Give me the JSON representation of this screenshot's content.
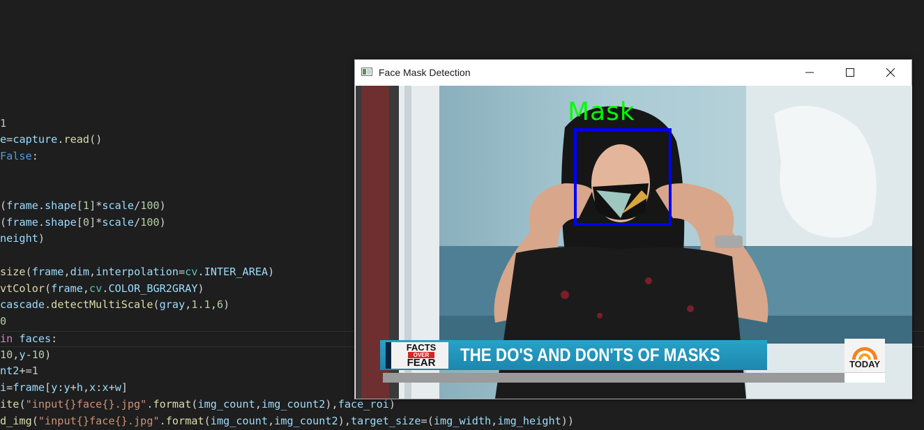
{
  "editor": {
    "lines": [
      [
        "<span class='n'>1</span>"
      ],
      [
        "<span class='v'>e</span>=<span class='v'>capture</span>.<span class='f'>read</span>()"
      ],
      [
        "<span class='k'>False</span>:"
      ],
      [
        "(<span class='v'>frame</span>.<span class='v'>shape</span>[<span class='n'>1</span>]*<span class='v'>scale</span>/<span class='n'>100</span>)"
      ],
      [
        "(<span class='v'>frame</span>.<span class='v'>shape</span>[<span class='n'>0</span>]*<span class='v'>scale</span>/<span class='n'>100</span>)"
      ],
      [
        "<span class='v'>neight</span>)"
      ],
      [
        "<span class='f'>size</span>(<span class='v'>frame</span>,<span class='v'>dim</span>,<span class='v'>interpolation</span>=<span class='cls'>cv</span>.<span class='v'>INTER_AREA</span>)"
      ],
      [
        "<span class='f'>vtColor</span>(<span class='v'>frame</span>,<span class='cls'>cv</span>.<span class='v'>COLOR_BGR2GRAY</span>)"
      ],
      [
        "<span class='v'>cascade</span>.<span class='f'>detectMultiScale</span>(<span class='v'>gray</span>,<span class='n'>1.1</span>,<span class='n'>6</span>)"
      ],
      [
        "<span class='n'>0</span>"
      ],
      [
        "<span class='c'>in</span> <span class='v'>faces</span>:"
      ],
      [
        "<span class='n'>10</span>,<span class='v'>y</span>-<span class='n'>10</span>)"
      ],
      [
        "<span class='v'>nt2</span>+=<span class='n'>1</span>"
      ],
      [
        "<span class='v'>i</span>=<span class='v'>frame</span>[<span class='v'>y</span>:<span class='v'>y</span>+<span class='v'>h</span>,<span class='v'>x</span>:<span class='v'>x</span>+<span class='v'>w</span>]"
      ],
      [
        "<span class='f'>ite</span>(<span class='s'>\"input{}face{}.jpg\"</span>.<span class='f'>format</span>(<span class='v'>img_count</span>,<span class='v'>img_count2</span>),<span class='v'>face_roi</span>)"
      ],
      [
        "<span class='f'>d_img</span>(<span class='s'>\"input{}face{}.jpg\"</span>.<span class='f'>format</span>(<span class='v'>img_count</span>,<span class='v'>img_count2</span>),<span class='v'>target_size</span>=(<span class='v'>img_width</span>,<span class='v'>img_height</span>))"
      ]
    ]
  },
  "window": {
    "title": "Face Mask Detection",
    "icon": "opencv-window-icon",
    "buttons": [
      "minimize",
      "maximize",
      "close"
    ]
  },
  "video": {
    "detection_label": "Mask",
    "label_color": "#00ff00",
    "box_color": "#0000ff",
    "logo_facts": "FACTS",
    "logo_over": "OVER",
    "logo_fear": "FEAR",
    "headline": "THE DO'S AND DON'TS OF MASKS",
    "network_logo": "TODAY"
  }
}
